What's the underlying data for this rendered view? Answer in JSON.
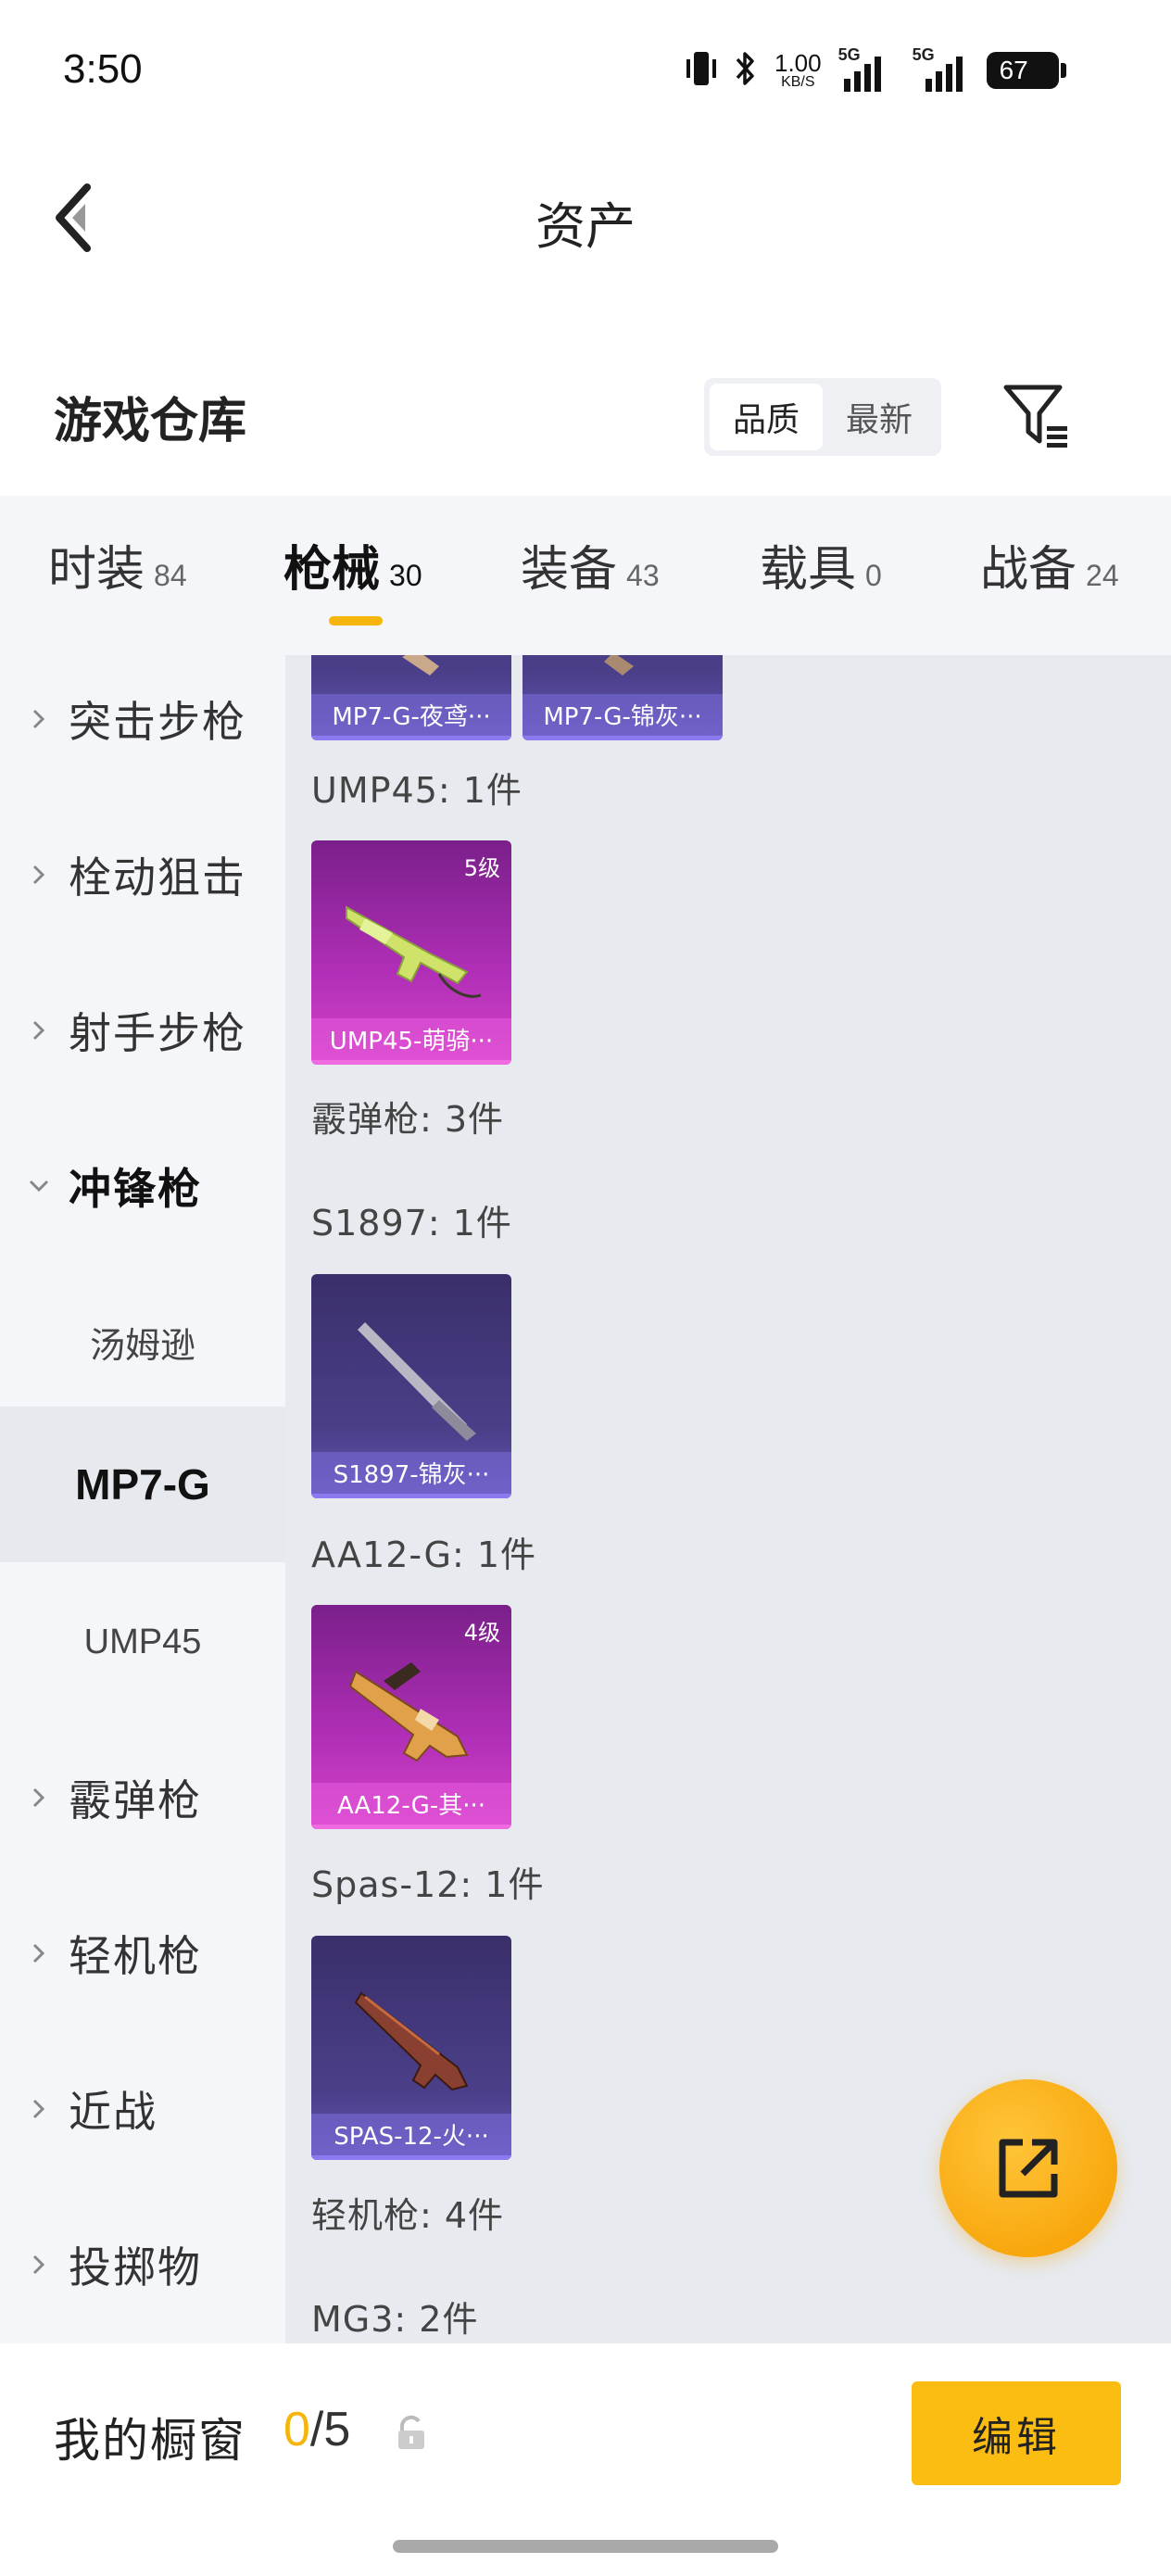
{
  "status_bar": {
    "time": "3:50",
    "net_speed_value": "1.00",
    "net_speed_unit": "KB/S",
    "signal_1_label": "5G",
    "signal_2_label": "5G",
    "battery": "67"
  },
  "header": {
    "title": "资产",
    "back_icon": "chevron-left-icon"
  },
  "warehouse": {
    "title": "游戏仓库",
    "sort_options": [
      "品质",
      "最新"
    ],
    "active_sort": "品质",
    "filter_icon": "filter-icon"
  },
  "tabs": [
    {
      "label": "时装",
      "count": "84",
      "active": false
    },
    {
      "label": "枪械",
      "count": "30",
      "active": true
    },
    {
      "label": "装备",
      "count": "43",
      "active": false
    },
    {
      "label": "载具",
      "count": "0",
      "active": false
    },
    {
      "label": "战备",
      "count": "24",
      "active": false
    }
  ],
  "categories": [
    {
      "label": "突击步枪",
      "expanded": false
    },
    {
      "label": "栓动狙击",
      "expanded": false
    },
    {
      "label": "射手步枪",
      "expanded": false
    },
    {
      "label": "冲锋枪",
      "expanded": true,
      "subitems": [
        "汤姆逊",
        "MP7-G",
        "UMP45"
      ],
      "selected_subitem": "MP7-G"
    },
    {
      "label": "霰弹枪",
      "expanded": false
    },
    {
      "label": "轻机枪",
      "expanded": false
    },
    {
      "label": "近战",
      "expanded": false
    },
    {
      "label": "投掷物",
      "expanded": false
    }
  ],
  "content": {
    "top_cards": [
      {
        "name": "MP7-G-夜鸢···",
        "rarity": "purple"
      },
      {
        "name": "MP7-G-锦灰···",
        "rarity": "purple"
      }
    ],
    "groups": [
      {
        "label": "UMP45: 1件",
        "cards": [
          {
            "name": "UMP45-萌骑···",
            "level": "5级",
            "rarity": "pink"
          }
        ]
      },
      {
        "label": "霰弹枪: 3件",
        "cards": []
      },
      {
        "label": "S1897: 1件",
        "cards": [
          {
            "name": "S1897-锦灰···",
            "rarity": "purple"
          }
        ]
      },
      {
        "label": "AA12-G: 1件",
        "cards": [
          {
            "name": "AA12-G-其···",
            "level": "4级",
            "rarity": "pink"
          }
        ]
      },
      {
        "label": "Spas-12: 1件",
        "cards": [
          {
            "name": "SPAS-12-火···",
            "rarity": "purple"
          }
        ]
      },
      {
        "label": "轻机枪: 4件",
        "cards": []
      },
      {
        "label": "MG3: 2件",
        "cards": []
      }
    ]
  },
  "fab": {
    "icon": "share-external-icon"
  },
  "showcase": {
    "label": "我的橱窗",
    "current": "0",
    "total": "/5",
    "lock_icon": "lock-icon",
    "edit_label": "编辑"
  },
  "colors": {
    "accent": "#f5b50b",
    "edit_button": "#fbbd12",
    "content_bg": "#e7eaef",
    "sidebar_bg": "#f4f6fa",
    "card_purple": "#4b3f8a",
    "card_pink": "#b22fb8"
  }
}
